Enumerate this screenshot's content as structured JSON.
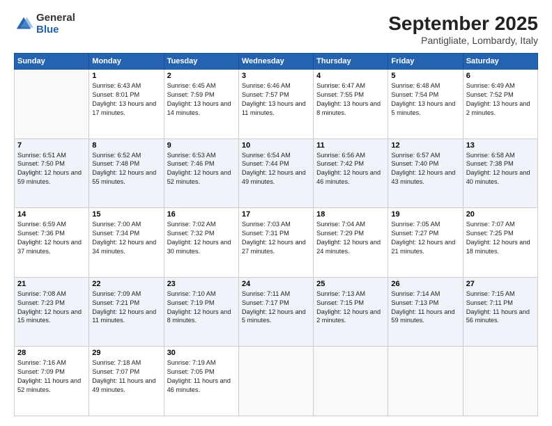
{
  "logo": {
    "general": "General",
    "blue": "Blue"
  },
  "title": "September 2025",
  "subtitle": "Pantigliate, Lombardy, Italy",
  "days_of_week": [
    "Sunday",
    "Monday",
    "Tuesday",
    "Wednesday",
    "Thursday",
    "Friday",
    "Saturday"
  ],
  "weeks": [
    [
      {
        "day": "",
        "sunrise": "",
        "sunset": "",
        "daylight": ""
      },
      {
        "day": "1",
        "sunrise": "Sunrise: 6:43 AM",
        "sunset": "Sunset: 8:01 PM",
        "daylight": "Daylight: 13 hours and 17 minutes."
      },
      {
        "day": "2",
        "sunrise": "Sunrise: 6:45 AM",
        "sunset": "Sunset: 7:59 PM",
        "daylight": "Daylight: 13 hours and 14 minutes."
      },
      {
        "day": "3",
        "sunrise": "Sunrise: 6:46 AM",
        "sunset": "Sunset: 7:57 PM",
        "daylight": "Daylight: 13 hours and 11 minutes."
      },
      {
        "day": "4",
        "sunrise": "Sunrise: 6:47 AM",
        "sunset": "Sunset: 7:55 PM",
        "daylight": "Daylight: 13 hours and 8 minutes."
      },
      {
        "day": "5",
        "sunrise": "Sunrise: 6:48 AM",
        "sunset": "Sunset: 7:54 PM",
        "daylight": "Daylight: 13 hours and 5 minutes."
      },
      {
        "day": "6",
        "sunrise": "Sunrise: 6:49 AM",
        "sunset": "Sunset: 7:52 PM",
        "daylight": "Daylight: 13 hours and 2 minutes."
      }
    ],
    [
      {
        "day": "7",
        "sunrise": "Sunrise: 6:51 AM",
        "sunset": "Sunset: 7:50 PM",
        "daylight": "Daylight: 12 hours and 59 minutes."
      },
      {
        "day": "8",
        "sunrise": "Sunrise: 6:52 AM",
        "sunset": "Sunset: 7:48 PM",
        "daylight": "Daylight: 12 hours and 55 minutes."
      },
      {
        "day": "9",
        "sunrise": "Sunrise: 6:53 AM",
        "sunset": "Sunset: 7:46 PM",
        "daylight": "Daylight: 12 hours and 52 minutes."
      },
      {
        "day": "10",
        "sunrise": "Sunrise: 6:54 AM",
        "sunset": "Sunset: 7:44 PM",
        "daylight": "Daylight: 12 hours and 49 minutes."
      },
      {
        "day": "11",
        "sunrise": "Sunrise: 6:56 AM",
        "sunset": "Sunset: 7:42 PM",
        "daylight": "Daylight: 12 hours and 46 minutes."
      },
      {
        "day": "12",
        "sunrise": "Sunrise: 6:57 AM",
        "sunset": "Sunset: 7:40 PM",
        "daylight": "Daylight: 12 hours and 43 minutes."
      },
      {
        "day": "13",
        "sunrise": "Sunrise: 6:58 AM",
        "sunset": "Sunset: 7:38 PM",
        "daylight": "Daylight: 12 hours and 40 minutes."
      }
    ],
    [
      {
        "day": "14",
        "sunrise": "Sunrise: 6:59 AM",
        "sunset": "Sunset: 7:36 PM",
        "daylight": "Daylight: 12 hours and 37 minutes."
      },
      {
        "day": "15",
        "sunrise": "Sunrise: 7:00 AM",
        "sunset": "Sunset: 7:34 PM",
        "daylight": "Daylight: 12 hours and 34 minutes."
      },
      {
        "day": "16",
        "sunrise": "Sunrise: 7:02 AM",
        "sunset": "Sunset: 7:32 PM",
        "daylight": "Daylight: 12 hours and 30 minutes."
      },
      {
        "day": "17",
        "sunrise": "Sunrise: 7:03 AM",
        "sunset": "Sunset: 7:31 PM",
        "daylight": "Daylight: 12 hours and 27 minutes."
      },
      {
        "day": "18",
        "sunrise": "Sunrise: 7:04 AM",
        "sunset": "Sunset: 7:29 PM",
        "daylight": "Daylight: 12 hours and 24 minutes."
      },
      {
        "day": "19",
        "sunrise": "Sunrise: 7:05 AM",
        "sunset": "Sunset: 7:27 PM",
        "daylight": "Daylight: 12 hours and 21 minutes."
      },
      {
        "day": "20",
        "sunrise": "Sunrise: 7:07 AM",
        "sunset": "Sunset: 7:25 PM",
        "daylight": "Daylight: 12 hours and 18 minutes."
      }
    ],
    [
      {
        "day": "21",
        "sunrise": "Sunrise: 7:08 AM",
        "sunset": "Sunset: 7:23 PM",
        "daylight": "Daylight: 12 hours and 15 minutes."
      },
      {
        "day": "22",
        "sunrise": "Sunrise: 7:09 AM",
        "sunset": "Sunset: 7:21 PM",
        "daylight": "Daylight: 12 hours and 11 minutes."
      },
      {
        "day": "23",
        "sunrise": "Sunrise: 7:10 AM",
        "sunset": "Sunset: 7:19 PM",
        "daylight": "Daylight: 12 hours and 8 minutes."
      },
      {
        "day": "24",
        "sunrise": "Sunrise: 7:11 AM",
        "sunset": "Sunset: 7:17 PM",
        "daylight": "Daylight: 12 hours and 5 minutes."
      },
      {
        "day": "25",
        "sunrise": "Sunrise: 7:13 AM",
        "sunset": "Sunset: 7:15 PM",
        "daylight": "Daylight: 12 hours and 2 minutes."
      },
      {
        "day": "26",
        "sunrise": "Sunrise: 7:14 AM",
        "sunset": "Sunset: 7:13 PM",
        "daylight": "Daylight: 11 hours and 59 minutes."
      },
      {
        "day": "27",
        "sunrise": "Sunrise: 7:15 AM",
        "sunset": "Sunset: 7:11 PM",
        "daylight": "Daylight: 11 hours and 56 minutes."
      }
    ],
    [
      {
        "day": "28",
        "sunrise": "Sunrise: 7:16 AM",
        "sunset": "Sunset: 7:09 PM",
        "daylight": "Daylight: 11 hours and 52 minutes."
      },
      {
        "day": "29",
        "sunrise": "Sunrise: 7:18 AM",
        "sunset": "Sunset: 7:07 PM",
        "daylight": "Daylight: 11 hours and 49 minutes."
      },
      {
        "day": "30",
        "sunrise": "Sunrise: 7:19 AM",
        "sunset": "Sunset: 7:05 PM",
        "daylight": "Daylight: 11 hours and 46 minutes."
      },
      {
        "day": "",
        "sunrise": "",
        "sunset": "",
        "daylight": ""
      },
      {
        "day": "",
        "sunrise": "",
        "sunset": "",
        "daylight": ""
      },
      {
        "day": "",
        "sunrise": "",
        "sunset": "",
        "daylight": ""
      },
      {
        "day": "",
        "sunrise": "",
        "sunset": "",
        "daylight": ""
      }
    ]
  ]
}
